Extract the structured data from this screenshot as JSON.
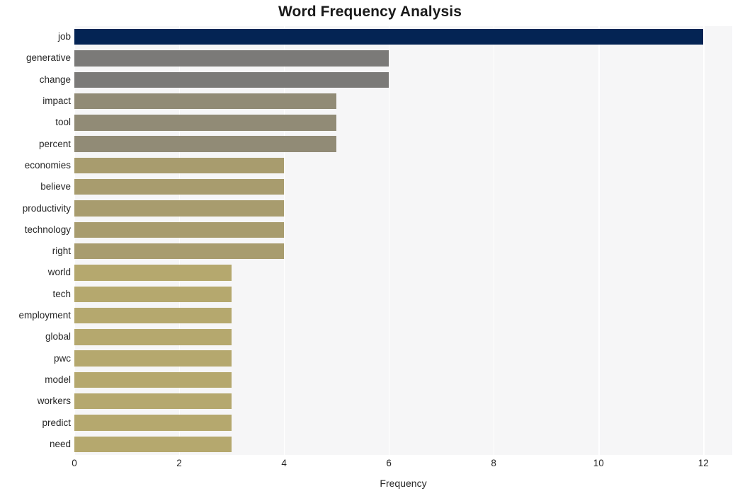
{
  "chart_data": {
    "type": "bar",
    "orientation": "horizontal",
    "title": "Word Frequency Analysis",
    "xlabel": "Frequency",
    "ylabel": "",
    "categories": [
      "job",
      "generative",
      "change",
      "impact",
      "tool",
      "percent",
      "economies",
      "believe",
      "productivity",
      "technology",
      "right",
      "world",
      "tech",
      "employment",
      "global",
      "pwc",
      "model",
      "workers",
      "predict",
      "need"
    ],
    "values": [
      12,
      6,
      6,
      5,
      5,
      5,
      4,
      4,
      4,
      4,
      4,
      3,
      3,
      3,
      3,
      3,
      3,
      3,
      3,
      3
    ],
    "bar_colors": [
      "#042454",
      "#7b7a78",
      "#7b7a78",
      "#918b76",
      "#918b76",
      "#918b76",
      "#a89c6e",
      "#a89c6e",
      "#a89c6e",
      "#a89c6e",
      "#a89c6e",
      "#b5a86e",
      "#b5a86e",
      "#b5a86e",
      "#b5a86e",
      "#b5a86e",
      "#b5a86e",
      "#b5a86e",
      "#b5a86e",
      "#b5a86e"
    ],
    "xlim": [
      0,
      12.55
    ],
    "xticks": [
      0,
      2,
      4,
      6,
      8,
      10,
      12
    ],
    "xtick_labels": [
      "0",
      "2",
      "4",
      "6",
      "8",
      "10",
      "12"
    ],
    "grid": "vertical-white-on-gray",
    "legend": "none",
    "plot_background": "#f6f6f7",
    "figure_background": "#ffffff"
  }
}
